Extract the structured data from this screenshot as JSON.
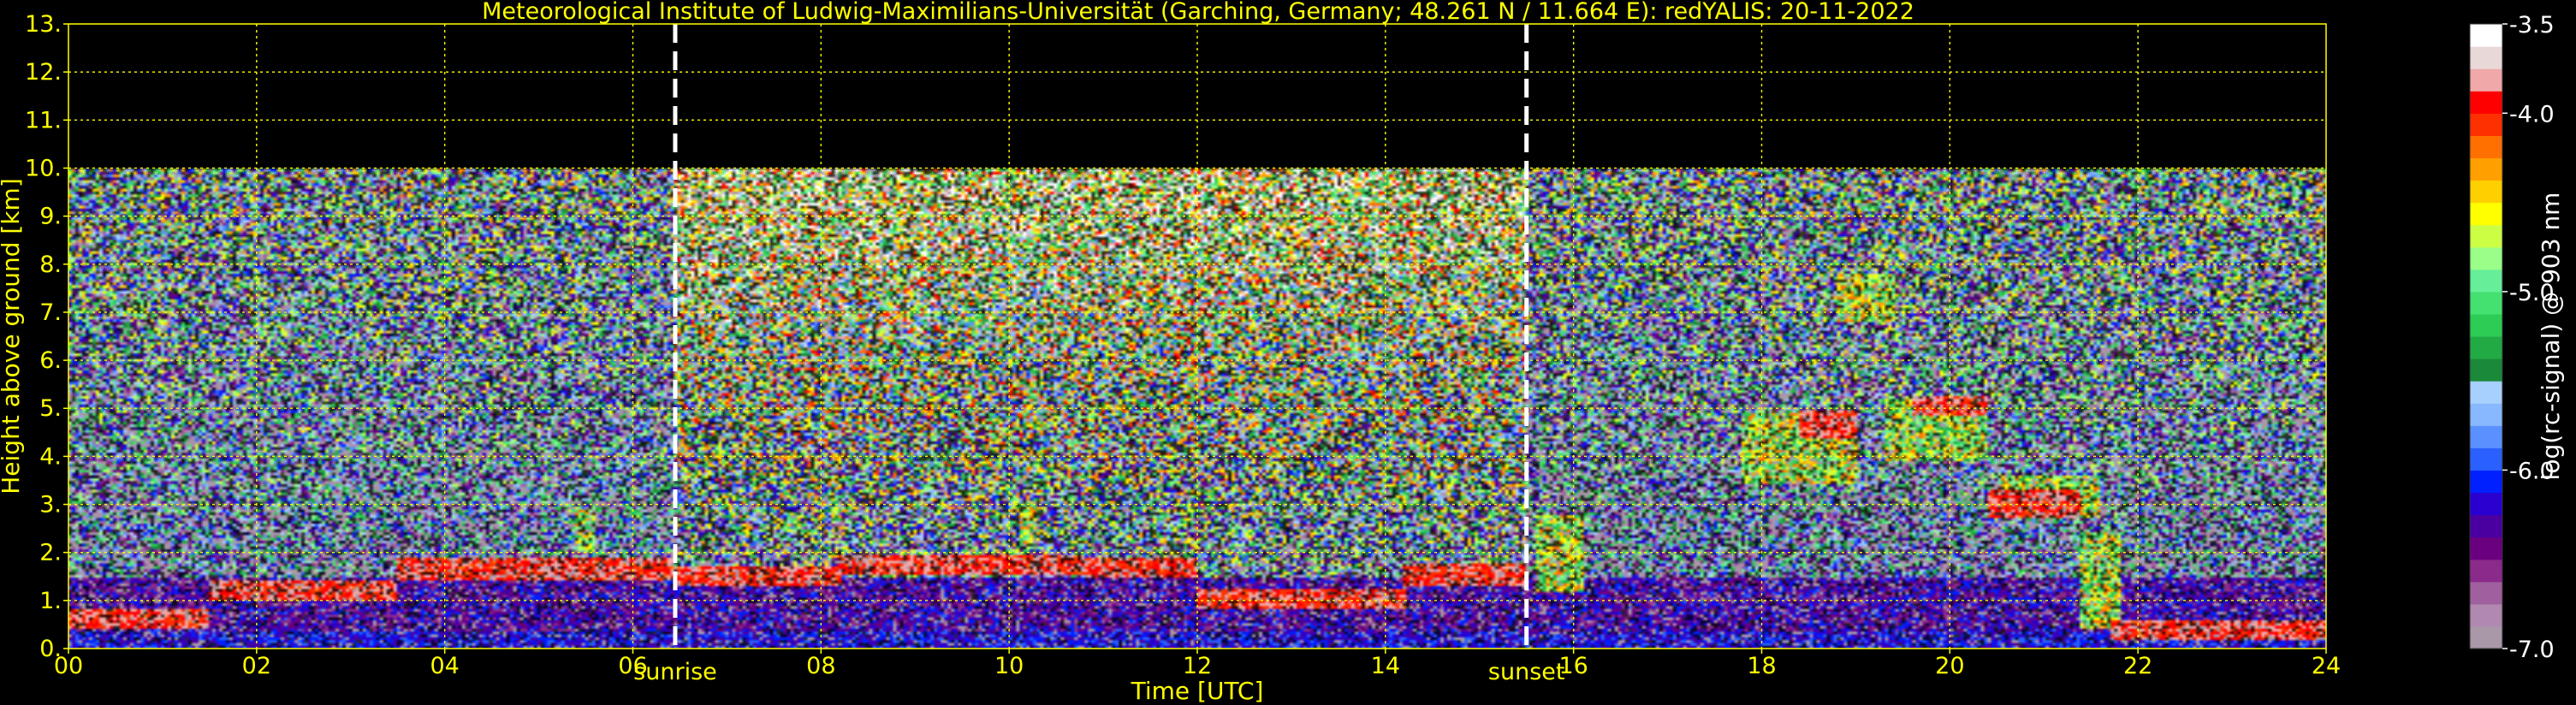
{
  "chart_data": {
    "type": "heatmap",
    "title": "Meteorological Institute of Ludwig-Maximilians-Universität (Garching, Germany; 48.261 N / 11.664 E):    redYALIS: 20-11-2022",
    "xlabel": "Time [UTC]",
    "ylabel": "Height above ground [km]",
    "xlim": [
      0,
      24
    ],
    "ylim": [
      0,
      13
    ],
    "x_ticks": [
      "00",
      "02",
      "04",
      "06",
      "08",
      "10",
      "12",
      "14",
      "16",
      "18",
      "20",
      "22",
      "24"
    ],
    "y_ticks": [
      "0.",
      "1.",
      "2.",
      "3.",
      "4.",
      "5.",
      "6.",
      "7.",
      "8.",
      "9.",
      "10.",
      "11.",
      "12.",
      "13."
    ],
    "grid": true,
    "grid_color": "#ffff00",
    "text_color": "#ffff00",
    "background": "#000000",
    "data_top_km": 10,
    "events": [
      {
        "label": "sunrise",
        "time": 6.45
      },
      {
        "label": "sunset",
        "time": 15.5
      }
    ],
    "colorbar": {
      "label": "log(rc-signal) @ 903 nm",
      "min": -7.0,
      "max": -3.5,
      "tick_labels": [
        "-3.5",
        "-4.0",
        "-5.0",
        "-6.0",
        "-7.0"
      ],
      "tick_values": [
        -3.5,
        -4.0,
        -5.0,
        -6.0,
        -7.0
      ],
      "colors": [
        "#a898a8",
        "#b088b0",
        "#a060a0",
        "#8a2a8a",
        "#6a0080",
        "#4a00a0",
        "#2a00d0",
        "#0020ff",
        "#2a60ff",
        "#5a90ff",
        "#88b8ff",
        "#a8d0ff",
        "#1a8a3a",
        "#22aa44",
        "#2ccc55",
        "#44e070",
        "#66ee99",
        "#99ff88",
        "#ccff44",
        "#ffff00",
        "#ffd000",
        "#ffa000",
        "#ff7000",
        "#ff3000",
        "#ff0000",
        "#f0a8a8",
        "#e8d8d8",
        "#ffffff"
      ]
    },
    "cloud_layers": [
      {
        "t0": 0.0,
        "t1": 1.5,
        "h": 0.6,
        "thickness": 0.2
      },
      {
        "t0": 1.5,
        "t1": 3.5,
        "h": 1.2,
        "thickness": 0.2
      },
      {
        "t0": 3.5,
        "t1": 6.45,
        "h": 1.65,
        "thickness": 0.25
      },
      {
        "t0": 6.45,
        "t1": 8.2,
        "h": 1.5,
        "thickness": 0.2
      },
      {
        "t0": 8.2,
        "t1": 10.8,
        "h": 1.75,
        "thickness": 0.2
      },
      {
        "t0": 10.8,
        "t1": 12.0,
        "h": 1.7,
        "thickness": 0.2
      },
      {
        "t0": 12.0,
        "t1": 14.2,
        "h": 1.05,
        "thickness": 0.2
      },
      {
        "t0": 14.2,
        "t1": 15.5,
        "h": 1.55,
        "thickness": 0.25
      },
      {
        "t0": 18.4,
        "t1": 19.0,
        "h": 4.65,
        "thickness": 0.3
      },
      {
        "t0": 19.6,
        "t1": 20.4,
        "h": 5.05,
        "thickness": 0.2
      },
      {
        "t0": 20.4,
        "t1": 21.4,
        "h": 3.0,
        "thickness": 0.3
      },
      {
        "t0": 21.7,
        "t1": 24.0,
        "h": 0.4,
        "thickness": 0.2
      }
    ],
    "high_clouds": [
      {
        "t0": 5.4,
        "t1": 5.6,
        "h0": 2.0,
        "h1": 2.9
      },
      {
        "t0": 10.1,
        "t1": 10.3,
        "h0": 2.2,
        "h1": 3.0
      },
      {
        "t0": 15.6,
        "t1": 16.1,
        "h0": 1.2,
        "h1": 2.8
      },
      {
        "t0": 17.8,
        "t1": 19.0,
        "h0": 3.4,
        "h1": 4.9
      },
      {
        "t0": 18.8,
        "t1": 19.4,
        "h0": 6.8,
        "h1": 7.8
      },
      {
        "t0": 19.3,
        "t1": 20.4,
        "h0": 3.9,
        "h1": 5.2
      },
      {
        "t0": 20.5,
        "t1": 21.6,
        "h0": 2.7,
        "h1": 3.6
      },
      {
        "t0": 21.4,
        "t1": 21.8,
        "h0": 0.4,
        "h1": 2.4
      }
    ]
  }
}
